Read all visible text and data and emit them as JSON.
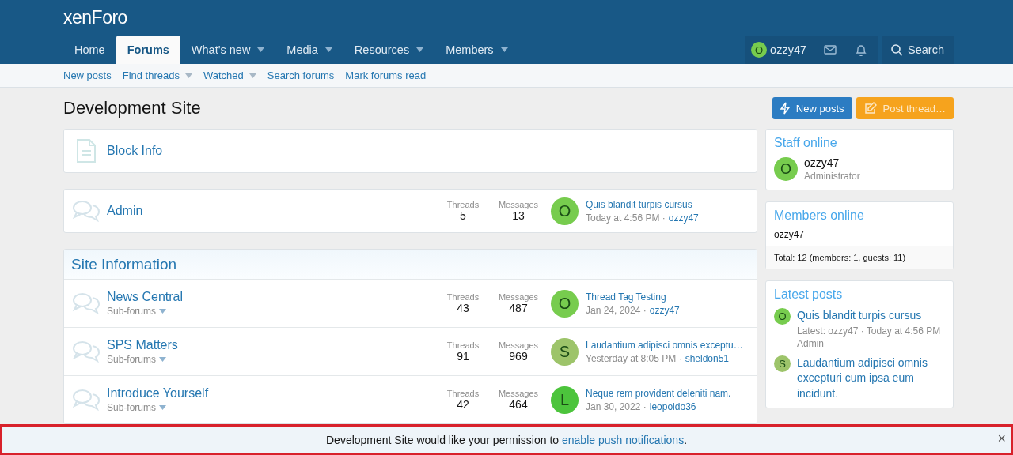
{
  "header": {
    "logo": "xenForo",
    "tabs": [
      {
        "label": "Home",
        "selected": false,
        "dropdown": false
      },
      {
        "label": "Forums",
        "selected": true,
        "dropdown": false
      },
      {
        "label": "What's new",
        "selected": false,
        "dropdown": true
      },
      {
        "label": "Media",
        "selected": false,
        "dropdown": true
      },
      {
        "label": "Resources",
        "selected": false,
        "dropdown": true
      },
      {
        "label": "Members",
        "selected": false,
        "dropdown": true
      }
    ],
    "user": {
      "avatar_letter": "O",
      "name": "ozzy47"
    },
    "search": "Search"
  },
  "subnav": [
    {
      "label": "New posts",
      "dropdown": false
    },
    {
      "label": "Find threads",
      "dropdown": true
    },
    {
      "label": "Watched",
      "dropdown": true
    },
    {
      "label": "Search forums",
      "dropdown": false
    },
    {
      "label": "Mark forums read",
      "dropdown": false
    }
  ],
  "page_title": "Development Site",
  "buttons": [
    {
      "label": "New posts",
      "kind": "primary"
    },
    {
      "label": "Post thread…",
      "kind": "cta"
    }
  ],
  "nodes": [
    {
      "kind": "page",
      "title": "Block Info"
    },
    {
      "kind": "forum",
      "title": "Admin",
      "threads_label": "Threads",
      "threads": "5",
      "messages_label": "Messages",
      "messages": "13",
      "latest": {
        "letter": "O",
        "color": "#77cc4e",
        "title": "Quis blandit turpis cursus",
        "date": "Today at 4:56 PM",
        "separator": "·",
        "user": "ozzy47"
      }
    }
  ],
  "categories": [
    {
      "title": "Site Information",
      "nodes": [
        {
          "kind": "forum",
          "title": "News Central",
          "subforums": "Sub-forums",
          "threads_label": "Threads",
          "threads": "43",
          "messages_label": "Messages",
          "messages": "487",
          "latest": {
            "letter": "O",
            "color": "#77cc4e",
            "title": "Thread Tag Testing",
            "date": "Jan 24, 2024",
            "separator": "·",
            "user": "ozzy47"
          }
        },
        {
          "kind": "forum",
          "title": "SPS Matters",
          "subforums": "Sub-forums",
          "threads_label": "Threads",
          "threads": "91",
          "messages_label": "Messages",
          "messages": "969",
          "latest": {
            "letter": "S",
            "color": "#9dc46a",
            "title": "Laudantium adipisci omnis exceptu…",
            "date": "Yesterday at 8:05 PM",
            "separator": "·",
            "user": "sheldon51"
          }
        },
        {
          "kind": "forum",
          "title": "Introduce Yourself",
          "subforums": "Sub-forums",
          "threads_label": "Threads",
          "threads": "42",
          "messages_label": "Messages",
          "messages": "464",
          "latest": {
            "letter": "L",
            "color": "#4cc43c",
            "title": "Neque rem provident deleniti nam.",
            "date": "Jan 30, 2022",
            "separator": "·",
            "user": "leopoldo36"
          }
        }
      ]
    }
  ],
  "sidebar": {
    "staff_online": {
      "title": "Staff online",
      "members": [
        {
          "letter": "O",
          "color": "#77cc4e",
          "name": "ozzy47",
          "role": "Administrator"
        }
      ]
    },
    "members_online": {
      "title": "Members online",
      "names": [
        "ozzy47"
      ],
      "total": "Total: 12 (members: 1, guests: 11)"
    },
    "latest_posts": {
      "title": "Latest posts",
      "posts": [
        {
          "letter": "O",
          "color": "#77cc4e",
          "title": "Quis blandit turpis cursus",
          "meta": "Latest: ozzy47 · Today at 4:56 PM",
          "forum": "Admin"
        },
        {
          "letter": "S",
          "color": "#9dc46a",
          "title": "Laudantium adipisci omnis excepturi cum ipsa eum incidunt."
        }
      ]
    }
  },
  "notice": {
    "text": "Development Site would like your permission to",
    "link": "enable push notifications",
    "end": ".",
    "close": "×"
  }
}
